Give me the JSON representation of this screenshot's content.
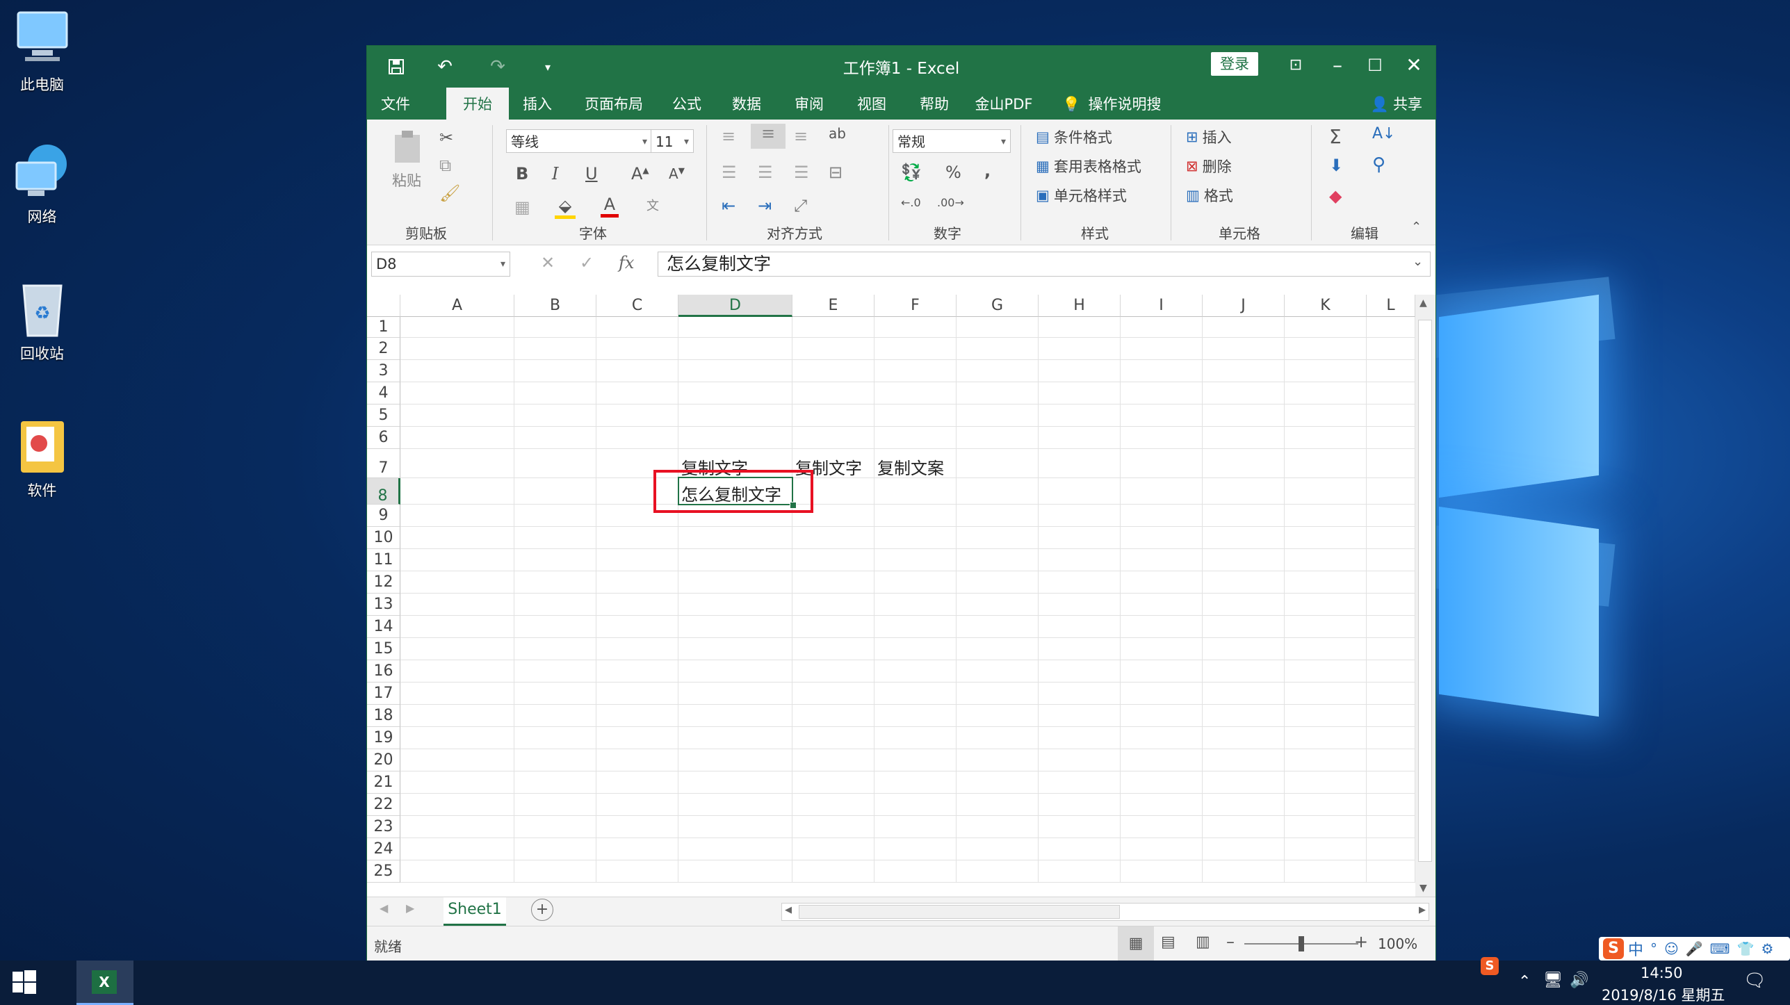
{
  "desktop": {
    "icons": [
      {
        "label": "此电脑",
        "icon": "computer-icon"
      },
      {
        "label": "网络",
        "icon": "network-icon"
      },
      {
        "label": "回收站",
        "icon": "recycle-bin-icon"
      },
      {
        "label": "软件",
        "icon": "folder-icon"
      }
    ]
  },
  "window": {
    "title": "工作簿1  -  Excel",
    "login_label": "登录",
    "share_label": "共享",
    "tell_me": "操作说明搜索"
  },
  "menu": [
    "文件",
    "开始",
    "插入",
    "页面布局",
    "公式",
    "数据",
    "审阅",
    "视图",
    "帮助",
    "金山PDF"
  ],
  "ribbon": {
    "groups": [
      "剪贴板",
      "字体",
      "对齐方式",
      "数字",
      "样式",
      "单元格",
      "编辑"
    ],
    "paste_label": "粘贴",
    "font_name": "等线",
    "font_size": "11",
    "number_format": "常规",
    "styles": [
      "条件格式",
      "套用表格格式",
      "单元格样式"
    ],
    "cells": [
      "插入",
      "删除",
      "格式"
    ]
  },
  "formula": {
    "name_box": "D8",
    "fx": "fx",
    "content": "怎么复制文字"
  },
  "grid": {
    "columns": [
      "A",
      "B",
      "C",
      "D",
      "E",
      "F",
      "G",
      "H",
      "I",
      "J",
      "K",
      "L"
    ],
    "rows": [
      "1",
      "2",
      "3",
      "4",
      "5",
      "6",
      "7",
      "8",
      "9",
      "10",
      "11",
      "12",
      "13",
      "14",
      "15",
      "16",
      "17",
      "18",
      "19",
      "20",
      "21",
      "22",
      "23",
      "24",
      "25"
    ],
    "cells": {
      "D7": "复制文字",
      "E7": "复制文字",
      "F7": "复制文案",
      "D8": "怎么复制文字"
    }
  },
  "sheets": [
    "Sheet1"
  ],
  "status": {
    "ready": "就绪",
    "zoom": "100%"
  },
  "taskbar": {
    "time": "14:50",
    "date": "2019/8/16 星期五",
    "ime": "中"
  },
  "colors": {
    "excel_green": "#217346",
    "highlight_red": "#e81123"
  }
}
